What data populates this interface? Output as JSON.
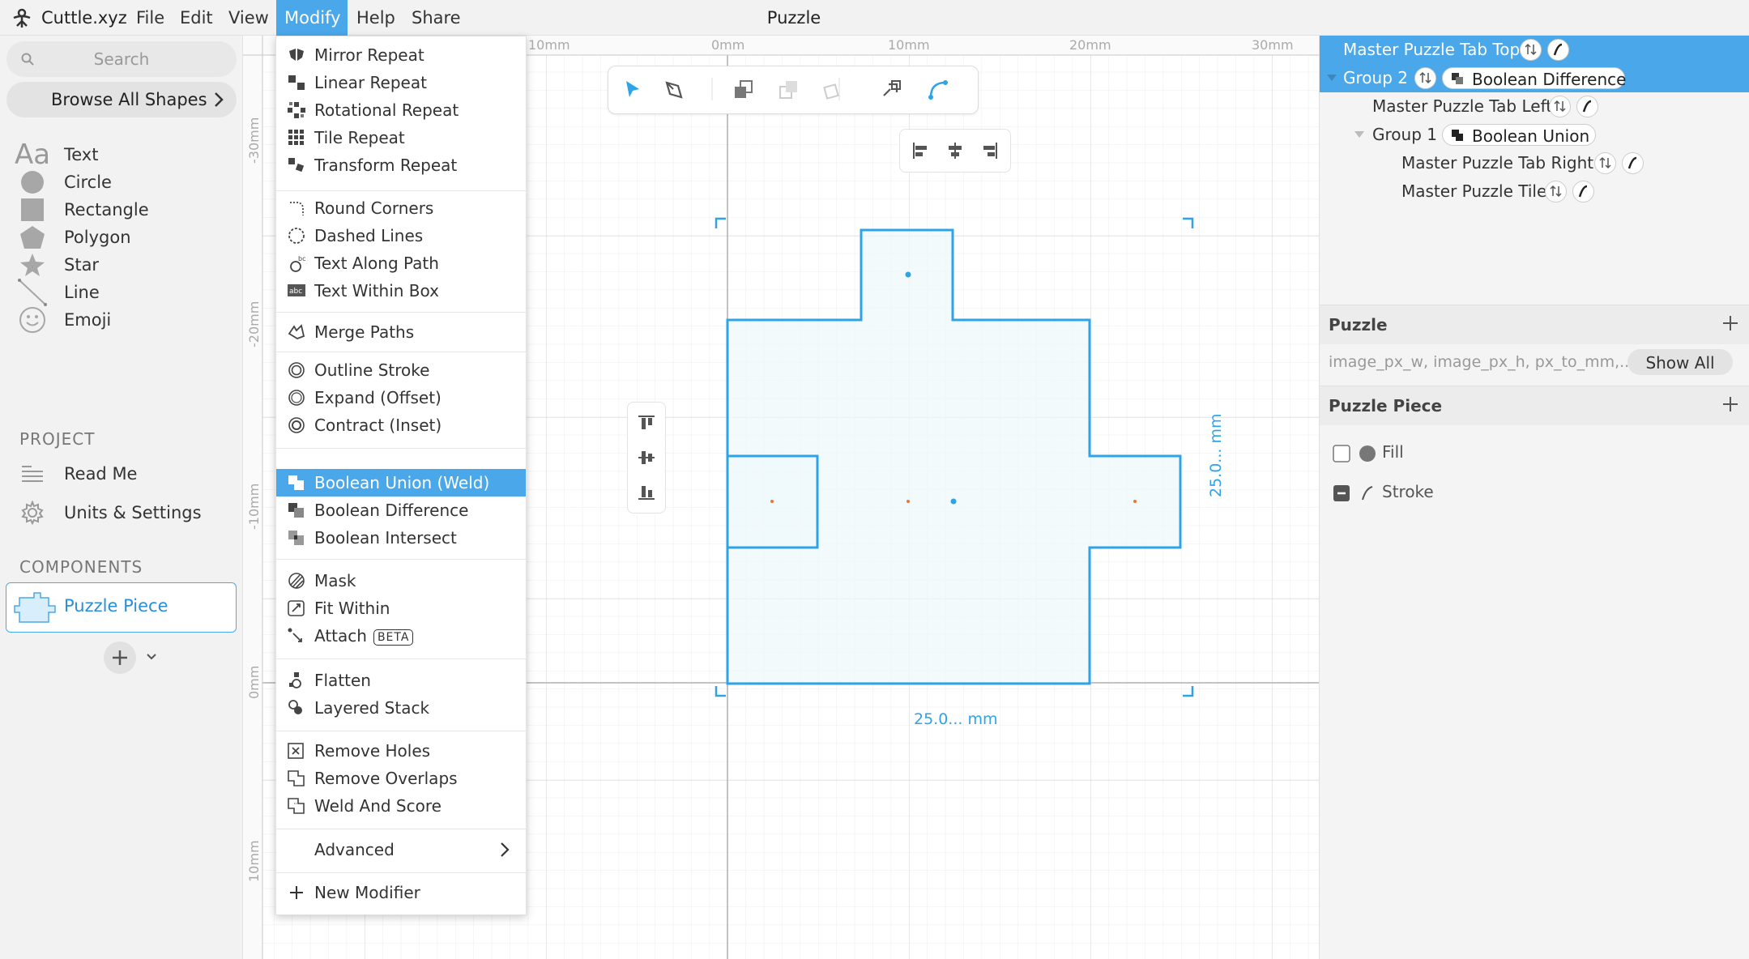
{
  "menubar": {
    "app_name": "Cuttle.xyz",
    "menus": [
      "File",
      "Edit",
      "View",
      "Modify",
      "Help",
      "Share"
    ],
    "active_menu": "Modify",
    "document_title": "Puzzle"
  },
  "sidebar": {
    "search_placeholder": "Search",
    "browse_label": "Browse All Shapes",
    "shapes": [
      {
        "label": "Text",
        "icon": "text-icon"
      },
      {
        "label": "Circle",
        "icon": "circle-icon"
      },
      {
        "label": "Rectangle",
        "icon": "rectangle-icon"
      },
      {
        "label": "Polygon",
        "icon": "polygon-icon"
      },
      {
        "label": "Star",
        "icon": "star-icon"
      },
      {
        "label": "Line",
        "icon": "line-icon"
      },
      {
        "label": "Emoji",
        "icon": "emoji-icon"
      }
    ],
    "project_heading": "PROJECT",
    "project_items": [
      {
        "label": "Read Me",
        "icon": "document-icon"
      },
      {
        "label": "Units & Settings",
        "icon": "gear-icon"
      }
    ],
    "components_heading": "COMPONENTS",
    "component": {
      "label": "Puzzle Piece",
      "icon": "puzzle-piece-icon"
    },
    "text_icon_glyph": "Aa"
  },
  "canvas": {
    "ruler_top": [
      "10mm",
      "0mm",
      "10mm",
      "20mm",
      "30mm"
    ],
    "ruler_left": [
      "-30mm",
      "-20mm",
      "-10mm",
      "0mm",
      "10mm"
    ],
    "width_label": "25.0... mm",
    "height_label": "25.0... mm",
    "accent_color": "#2ea4e8"
  },
  "modify_menu": {
    "groups": [
      [
        {
          "label": "Mirror Repeat",
          "icon": "mirror-repeat-icon"
        },
        {
          "label": "Linear Repeat",
          "icon": "linear-repeat-icon"
        },
        {
          "label": "Rotational Repeat",
          "icon": "rotational-repeat-icon"
        },
        {
          "label": "Tile Repeat",
          "icon": "tile-repeat-icon"
        },
        {
          "label": "Transform Repeat",
          "icon": "transform-repeat-icon"
        }
      ],
      [
        {
          "label": "Round Corners",
          "icon": "round-corners-icon"
        },
        {
          "label": "Dashed Lines",
          "icon": "dashed-lines-icon"
        },
        {
          "label": "Text Along Path",
          "icon": "text-along-path-icon"
        },
        {
          "label": "Text Within Box",
          "icon": "text-within-box-icon"
        }
      ],
      [
        {
          "label": "Merge Paths",
          "icon": "merge-paths-icon"
        }
      ],
      [
        {
          "label": "Outline Stroke",
          "icon": "outline-stroke-icon"
        },
        {
          "label": "Expand (Offset)",
          "icon": "expand-offset-icon"
        },
        {
          "label": "Contract (Inset)",
          "icon": "contract-inset-icon"
        }
      ],
      [
        {
          "label": "Boolean Union (Weld)",
          "icon": "boolean-union-icon",
          "active": true
        },
        {
          "label": "Boolean Difference",
          "icon": "boolean-difference-icon"
        },
        {
          "label": "Boolean Intersect",
          "icon": "boolean-intersect-icon"
        }
      ],
      [
        {
          "label": "Mask",
          "icon": "mask-icon"
        },
        {
          "label": "Fit Within",
          "icon": "fit-within-icon"
        },
        {
          "label": "Attach",
          "icon": "attach-icon",
          "badge": "BETA"
        }
      ],
      [
        {
          "label": "Flatten",
          "icon": "flatten-icon"
        },
        {
          "label": "Layered Stack",
          "icon": "layered-stack-icon"
        }
      ],
      [
        {
          "label": "Remove Holes",
          "icon": "remove-holes-icon"
        },
        {
          "label": "Remove Overlaps",
          "icon": "remove-overlaps-icon"
        },
        {
          "label": "Weld And Score",
          "icon": "weld-and-score-icon"
        }
      ],
      [
        {
          "label": "Advanced",
          "icon": "chevron-right-icon",
          "submenu": true
        }
      ],
      [
        {
          "label": "New Modifier",
          "icon": "plus-icon"
        }
      ]
    ]
  },
  "layers": [
    {
      "label": "Master Puzzle Tab Top",
      "selected": true
    },
    {
      "label": "Group 2",
      "selected": true,
      "modifier": "Boolean Difference"
    },
    {
      "label": "Master Puzzle Tab Left"
    },
    {
      "label": "Group 1",
      "modifier": "Boolean Union"
    },
    {
      "label": "Master Puzzle Tab Right"
    },
    {
      "label": "Master Puzzle Tile"
    }
  ],
  "params_panel": {
    "title": "Puzzle",
    "params_text": "image_px_w, image_px_h, px_to_mm,...",
    "show_all": "Show All"
  },
  "component_panel": {
    "title": "Puzzle Piece",
    "fill_label": "Fill",
    "stroke_label": "Stroke"
  }
}
